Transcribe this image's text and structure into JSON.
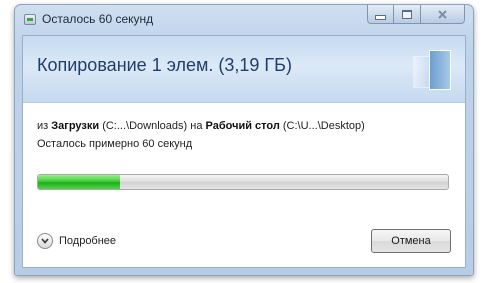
{
  "window": {
    "title": "Осталось 60 секунд"
  },
  "header": {
    "title": "Копирование 1 элем. (3,19 ГБ)"
  },
  "transfer": {
    "from_word": "из",
    "source_name": "Загрузки",
    "source_path": "(C:...\\Downloads)",
    "to_word": "на",
    "dest_name": "Рабочий стол",
    "dest_path": "(C:\\U...\\Desktop)",
    "time_remaining": "Осталось примерно 60 секунд",
    "progress_fraction": 0.2
  },
  "footer": {
    "details_label": "Подробнее",
    "cancel_label": "Отмена"
  },
  "icons": {
    "window_icon": "copy-dialog-icon",
    "minimize": "minimize-icon",
    "maximize": "maximize-icon",
    "close": "close-icon",
    "details": "chevron-down-circle-icon"
  },
  "colors": {
    "progress": "#2fbf2f",
    "header_text": "#1f3e6b"
  }
}
